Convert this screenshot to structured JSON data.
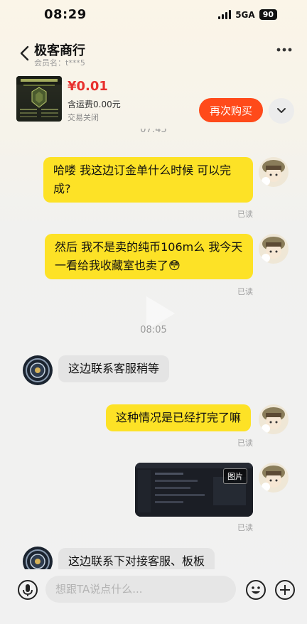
{
  "status_bar": {
    "time": "08:29",
    "network": "5GA",
    "battery": "90"
  },
  "header": {
    "shop_name": "极客商行",
    "member_label": "会员名：t***5"
  },
  "product": {
    "price": "¥0.01",
    "shipping": "含运费0.00元",
    "status": "交易关闭",
    "buy_again_label": "再次购买"
  },
  "chat": {
    "time_top_partial": "07:45",
    "msg1": {
      "text": "哈喽  我这边订金单什么时候 可以完成?",
      "read": "已读"
    },
    "msg2": {
      "text": "然后 我不是卖的纯币106m么 我今天一看给我收藏室也卖了",
      "emoji": "😳",
      "read": "已读"
    },
    "time_mid": "08:05",
    "msg3": {
      "text": "这边联系客服稍等"
    },
    "msg4": {
      "text": "这种情况是已经打完了嘛",
      "read": "已读"
    },
    "msg5": {
      "image_label": "图片",
      "read": "已读"
    },
    "msg6": {
      "text": "这边联系下对接客服、板板"
    }
  },
  "input": {
    "placeholder": "想跟TA说点什么..."
  },
  "icons": [
    "back-icon",
    "more-icon",
    "chevron-down-icon",
    "play-icon",
    "voice-icon",
    "emoji-icon",
    "plus-icon"
  ],
  "colors": {
    "accent": "#ff4a1a",
    "price": "#e8312f",
    "my_bubble": "#fde226",
    "their_bubble": "#e4e4e4"
  }
}
